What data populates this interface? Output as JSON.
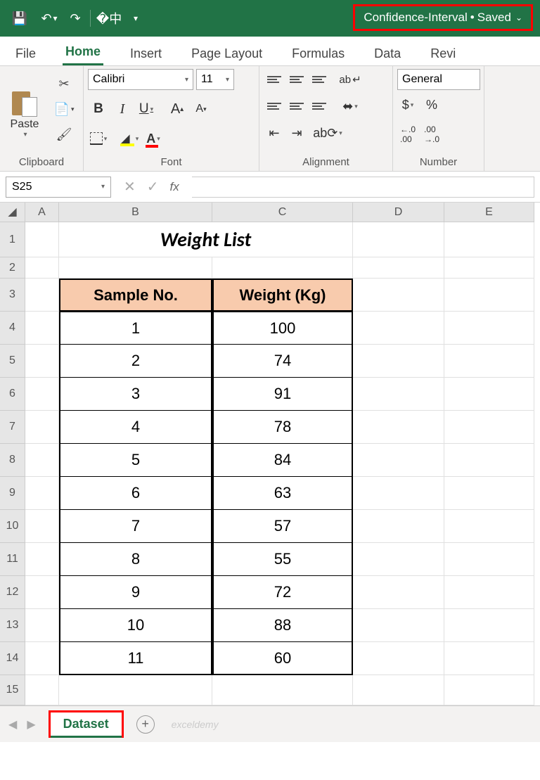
{
  "titlebar": {
    "doc": "Confidence-Interval",
    "status": "Saved"
  },
  "tabs": {
    "file": "File",
    "home": "Home",
    "insert": "Insert",
    "pagelayout": "Page Layout",
    "formulas": "Formulas",
    "data": "Data",
    "review": "Revi"
  },
  "ribbon": {
    "clipboard_label": "Clipboard",
    "paste": "Paste",
    "font_label": "Font",
    "font_name": "Calibri",
    "font_size": "11",
    "bold": "B",
    "italic": "I",
    "underline": "U",
    "growfont": "A",
    "shrinkfont": "A",
    "align_label": "Alignment",
    "wrap": "ab",
    "num_label": "Number",
    "num_format": "General",
    "currency": "$",
    "percent": "%",
    "inc": ".00",
    "dec": ".00"
  },
  "namebox": "S25",
  "fx": "fx",
  "columns": [
    "",
    "A",
    "B",
    "C",
    "D",
    "E"
  ],
  "sheet_title": "Weight List",
  "table": {
    "h1": "Sample No.",
    "h2": "Weight (Kg)",
    "rows": [
      {
        "n": "1",
        "w": "100"
      },
      {
        "n": "2",
        "w": "74"
      },
      {
        "n": "3",
        "w": "91"
      },
      {
        "n": "4",
        "w": "78"
      },
      {
        "n": "5",
        "w": "84"
      },
      {
        "n": "6",
        "w": "63"
      },
      {
        "n": "7",
        "w": "57"
      },
      {
        "n": "8",
        "w": "55"
      },
      {
        "n": "9",
        "w": "72"
      },
      {
        "n": "10",
        "w": "88"
      },
      {
        "n": "11",
        "w": "60"
      }
    ]
  },
  "rownums": [
    "1",
    "2",
    "3",
    "4",
    "5",
    "6",
    "7",
    "8",
    "9",
    "10",
    "11",
    "12",
    "13",
    "14",
    "15"
  ],
  "sheettab": "Dataset",
  "watermark": "exceldemy"
}
